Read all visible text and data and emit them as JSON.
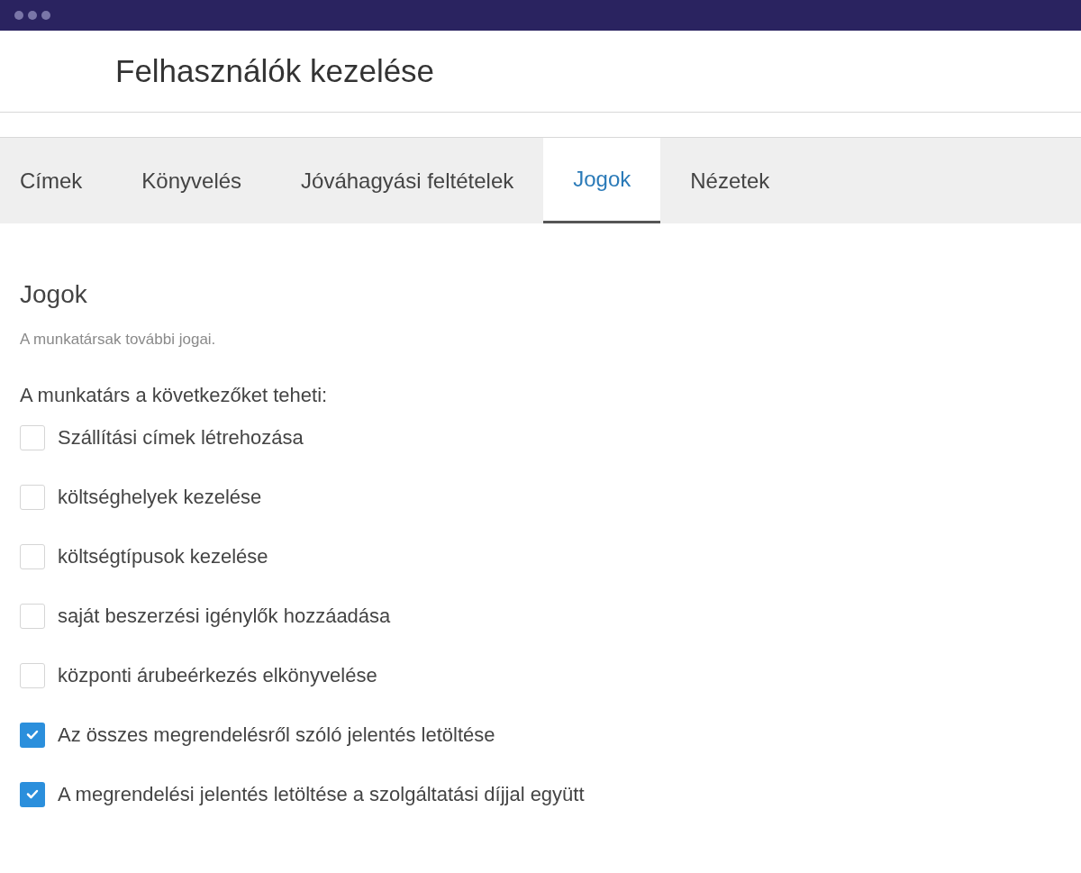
{
  "page": {
    "title": "Felhasználók kezelése"
  },
  "tabs": [
    {
      "label": "Címek",
      "selected": false
    },
    {
      "label": "Könyvelés",
      "selected": false
    },
    {
      "label": "Jóváhagyási feltételek",
      "selected": false
    },
    {
      "label": "Jogok",
      "selected": true
    },
    {
      "label": "Nézetek",
      "selected": false
    }
  ],
  "section": {
    "heading": "Jogok",
    "description": "A munkatársak további jogai.",
    "intro": "A munkatárs a következőket teheti:"
  },
  "permissions": [
    {
      "label": "Szállítási címek létrehozása",
      "checked": false
    },
    {
      "label": "költséghelyek kezelése",
      "checked": false
    },
    {
      "label": "költségtípusok kezelése",
      "checked": false
    },
    {
      "label": "saját beszerzési igénylők hozzáadása",
      "checked": false
    },
    {
      "label": "központi árubeérkezés elkönyvelése",
      "checked": false
    },
    {
      "label": "Az összes megrendelésről szóló jelentés letöltése",
      "checked": true
    },
    {
      "label": "A megrendelési jelentés letöltése a szolgáltatási díjjal együtt",
      "checked": true
    }
  ]
}
